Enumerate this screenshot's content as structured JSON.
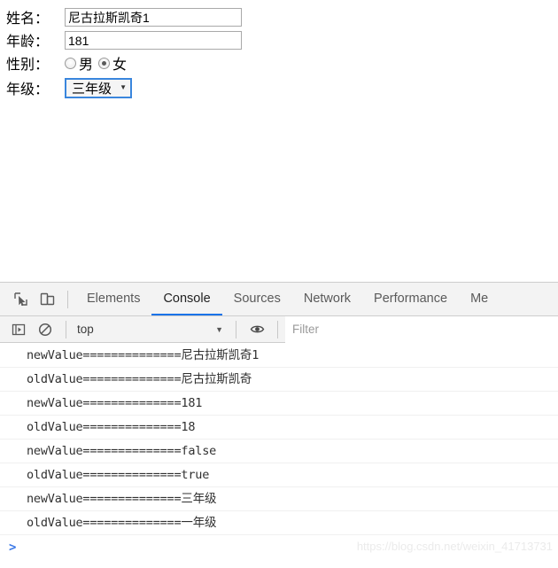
{
  "page": {
    "form": {
      "fields": [
        {
          "label": "姓名：",
          "type": "text",
          "value": "尼古拉斯凯奇1"
        },
        {
          "label": "年龄：",
          "type": "text",
          "value": "181"
        },
        {
          "label": "性别：",
          "type": "radio"
        },
        {
          "label": "年级：",
          "type": "select",
          "value": "三年级",
          "caret": "▼"
        }
      ],
      "gender": {
        "options": [
          {
            "label": "男",
            "checked": false
          },
          {
            "label": "女",
            "checked": true
          }
        ]
      }
    }
  },
  "devtools": {
    "tabs": [
      {
        "label": "Elements",
        "active": false
      },
      {
        "label": "Console",
        "active": true
      },
      {
        "label": "Sources",
        "active": false
      },
      {
        "label": "Network",
        "active": false
      },
      {
        "label": "Performance",
        "active": false
      },
      {
        "label": "Me",
        "active": false
      }
    ],
    "icons": {
      "inspect": "inspect-element-icon",
      "device": "device-toolbar-icon",
      "sidebar": "console-sidebar-icon",
      "clear": "clear-console-icon",
      "eye": "live-expression-icon"
    },
    "filterbar": {
      "context": "top",
      "context_caret": "▼",
      "filter_placeholder": "Filter"
    },
    "console_messages": [
      "newValue==============尼古拉斯凯奇1",
      "oldValue==============尼古拉斯凯奇",
      "newValue==============181",
      "oldValue==============18",
      "newValue==============false",
      "oldValue==============true",
      "newValue==============三年级",
      "oldValue==============一年级"
    ],
    "prompt": ">",
    "accent_color": "#1a73e8"
  },
  "watermark": "https://blog.csdn.net/weixin_41713731"
}
